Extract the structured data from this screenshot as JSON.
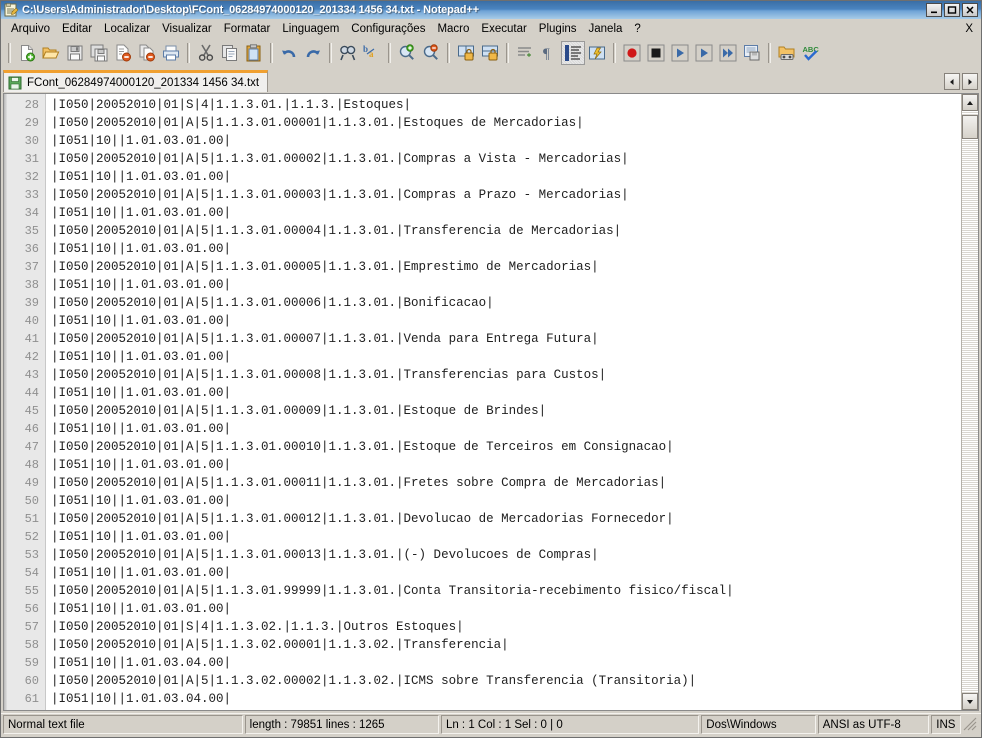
{
  "window": {
    "title": "C:\\Users\\Administrador\\Desktop\\FCont_06284974000120_201334 1456 34.txt - Notepad++",
    "minimize_label": "_",
    "maximize_label": "□",
    "close_label": "✕"
  },
  "menubar": {
    "items": [
      {
        "label": "Arquivo"
      },
      {
        "label": "Editar"
      },
      {
        "label": "Localizar"
      },
      {
        "label": "Visualizar"
      },
      {
        "label": "Formatar"
      },
      {
        "label": "Linguagem"
      },
      {
        "label": "Configurações"
      },
      {
        "label": "Macro"
      },
      {
        "label": "Executar"
      },
      {
        "label": "Plugins"
      },
      {
        "label": "Janela"
      },
      {
        "label": "?"
      }
    ],
    "close_document_label": "X"
  },
  "toolbar": {
    "buttons": [
      {
        "name": "new-file-icon",
        "title": "Novo"
      },
      {
        "name": "open-file-icon",
        "title": "Abrir"
      },
      {
        "name": "save-icon",
        "title": "Salvar"
      },
      {
        "name": "save-all-icon",
        "title": "Salvar tudo"
      },
      {
        "name": "close-file-icon",
        "title": "Fechar"
      },
      {
        "name": "close-all-files-icon",
        "title": "Fechar tudo"
      },
      {
        "name": "print-icon",
        "title": "Imprimir"
      },
      {
        "name": "cut-icon",
        "title": "Recortar"
      },
      {
        "name": "copy-icon",
        "title": "Copiar"
      },
      {
        "name": "paste-icon",
        "title": "Colar"
      },
      {
        "name": "undo-icon",
        "title": "Desfazer"
      },
      {
        "name": "redo-icon",
        "title": "Refazer"
      },
      {
        "name": "find-icon",
        "title": "Localizar"
      },
      {
        "name": "replace-icon",
        "title": "Substituir"
      },
      {
        "name": "zoom-in-icon",
        "title": "Ampliar"
      },
      {
        "name": "zoom-out-icon",
        "title": "Reduzir"
      },
      {
        "name": "sync-vertical-icon",
        "title": "Sincronizar rolagem vertical"
      },
      {
        "name": "sync-horizontal-icon",
        "title": "Sincronizar rolagem horizontal"
      },
      {
        "name": "word-wrap-icon",
        "title": "Quebra de linha"
      },
      {
        "name": "show-all-chars-icon",
        "title": "Mostrar todos os caracteres"
      },
      {
        "name": "indent-guide-icon",
        "title": "Guia de indentação"
      },
      {
        "name": "user-define-icon",
        "title": "Linguagem definida pelo usuário"
      },
      {
        "name": "record-macro-icon",
        "title": "Gravar macro"
      },
      {
        "name": "stop-macro-icon",
        "title": "Parar gravação"
      },
      {
        "name": "play-macro-icon",
        "title": "Executar macro"
      },
      {
        "name": "run-macro-once-icon",
        "title": "Executar macro"
      },
      {
        "name": "run-macro-multi-icon",
        "title": "Executar macro várias vezes"
      },
      {
        "name": "save-macro-icon",
        "title": "Salvar macro gravada"
      },
      {
        "name": "folder-as-workspace-icon",
        "title": "Pasta como espaço de trabalho"
      },
      {
        "name": "spell-check-icon",
        "title": "Verificação ortográfica"
      }
    ]
  },
  "tabs": {
    "active_index": 0,
    "items": [
      {
        "label": "FCont_06284974000120_201334 1456 34.txt"
      }
    ],
    "scroll_left_label": "◄",
    "scroll_right_label": "►"
  },
  "editor": {
    "first_line_number": 28,
    "lines": [
      {
        "num": "28",
        "text": "|I050|20052010|01|S|4|1.1.3.01.|1.1.3.|Estoques|"
      },
      {
        "num": "29",
        "text": "|I050|20052010|01|A|5|1.1.3.01.00001|1.1.3.01.|Estoques de Mercadorias|"
      },
      {
        "num": "30",
        "text": "|I051|10||1.01.03.01.00|"
      },
      {
        "num": "31",
        "text": "|I050|20052010|01|A|5|1.1.3.01.00002|1.1.3.01.|Compras a Vista - Mercadorias|"
      },
      {
        "num": "32",
        "text": "|I051|10||1.01.03.01.00|"
      },
      {
        "num": "33",
        "text": "|I050|20052010|01|A|5|1.1.3.01.00003|1.1.3.01.|Compras a Prazo - Mercadorias|"
      },
      {
        "num": "34",
        "text": "|I051|10||1.01.03.01.00|"
      },
      {
        "num": "35",
        "text": "|I050|20052010|01|A|5|1.1.3.01.00004|1.1.3.01.|Transferencia de Mercadorias|"
      },
      {
        "num": "36",
        "text": "|I051|10||1.01.03.01.00|"
      },
      {
        "num": "37",
        "text": "|I050|20052010|01|A|5|1.1.3.01.00005|1.1.3.01.|Emprestimo de Mercadorias|"
      },
      {
        "num": "38",
        "text": "|I051|10||1.01.03.01.00|"
      },
      {
        "num": "39",
        "text": "|I050|20052010|01|A|5|1.1.3.01.00006|1.1.3.01.|Bonificacao|"
      },
      {
        "num": "40",
        "text": "|I051|10||1.01.03.01.00|"
      },
      {
        "num": "41",
        "text": "|I050|20052010|01|A|5|1.1.3.01.00007|1.1.3.01.|Venda para Entrega Futura|"
      },
      {
        "num": "42",
        "text": "|I051|10||1.01.03.01.00|"
      },
      {
        "num": "43",
        "text": "|I050|20052010|01|A|5|1.1.3.01.00008|1.1.3.01.|Transferencias para Custos|"
      },
      {
        "num": "44",
        "text": "|I051|10||1.01.03.01.00|"
      },
      {
        "num": "45",
        "text": "|I050|20052010|01|A|5|1.1.3.01.00009|1.1.3.01.|Estoque de Brindes|"
      },
      {
        "num": "46",
        "text": "|I051|10||1.01.03.01.00|"
      },
      {
        "num": "47",
        "text": "|I050|20052010|01|A|5|1.1.3.01.00010|1.1.3.01.|Estoque de Terceiros em Consignacao|"
      },
      {
        "num": "48",
        "text": "|I051|10||1.01.03.01.00|"
      },
      {
        "num": "49",
        "text": "|I050|20052010|01|A|5|1.1.3.01.00011|1.1.3.01.|Fretes sobre Compra de Mercadorias|"
      },
      {
        "num": "50",
        "text": "|I051|10||1.01.03.01.00|"
      },
      {
        "num": "51",
        "text": "|I050|20052010|01|A|5|1.1.3.01.00012|1.1.3.01.|Devolucao de Mercadorias Fornecedor|"
      },
      {
        "num": "52",
        "text": "|I051|10||1.01.03.01.00|"
      },
      {
        "num": "53",
        "text": "|I050|20052010|01|A|5|1.1.3.01.00013|1.1.3.01.|(-) Devolucoes de Compras|"
      },
      {
        "num": "54",
        "text": "|I051|10||1.01.03.01.00|"
      },
      {
        "num": "55",
        "text": "|I050|20052010|01|A|5|1.1.3.01.99999|1.1.3.01.|Conta Transitoria-recebimento fisico/fiscal|"
      },
      {
        "num": "56",
        "text": "|I051|10||1.01.03.01.00|"
      },
      {
        "num": "57",
        "text": "|I050|20052010|01|S|4|1.1.3.02.|1.1.3.|Outros Estoques|"
      },
      {
        "num": "58",
        "text": "|I050|20052010|01|A|5|1.1.3.02.00001|1.1.3.02.|Transferencia|"
      },
      {
        "num": "59",
        "text": "|I051|10||1.01.03.04.00|"
      },
      {
        "num": "60",
        "text": "|I050|20052010|01|A|5|1.1.3.02.00002|1.1.3.02.|ICMS sobre Transferencia (Transitoria)|"
      },
      {
        "num": "61",
        "text": "|I051|10||1.01.03.04.00|"
      }
    ]
  },
  "scrollbar": {
    "up_arrow": "▲",
    "down_arrow": "▼"
  },
  "statusbar": {
    "file_type": "Normal text file",
    "length_lines": "length : 79851   lines : 1265",
    "caret": "Ln : 1   Col : 1   Sel : 0 | 0",
    "eol": "Dos\\Windows",
    "encoding": "ANSI as UTF-8",
    "insert_mode": "INS"
  },
  "colors": {
    "title_bar_start": "#3a6ea5",
    "title_bar_end": "#a8cbe8",
    "window_face": "#d4d0c8",
    "editor_bg": "#ffffff",
    "gutter_bg": "#e8e8e8",
    "gutter_text": "#8f8f8f",
    "code_text": "#202020",
    "tab_accent": "#f0a030"
  }
}
